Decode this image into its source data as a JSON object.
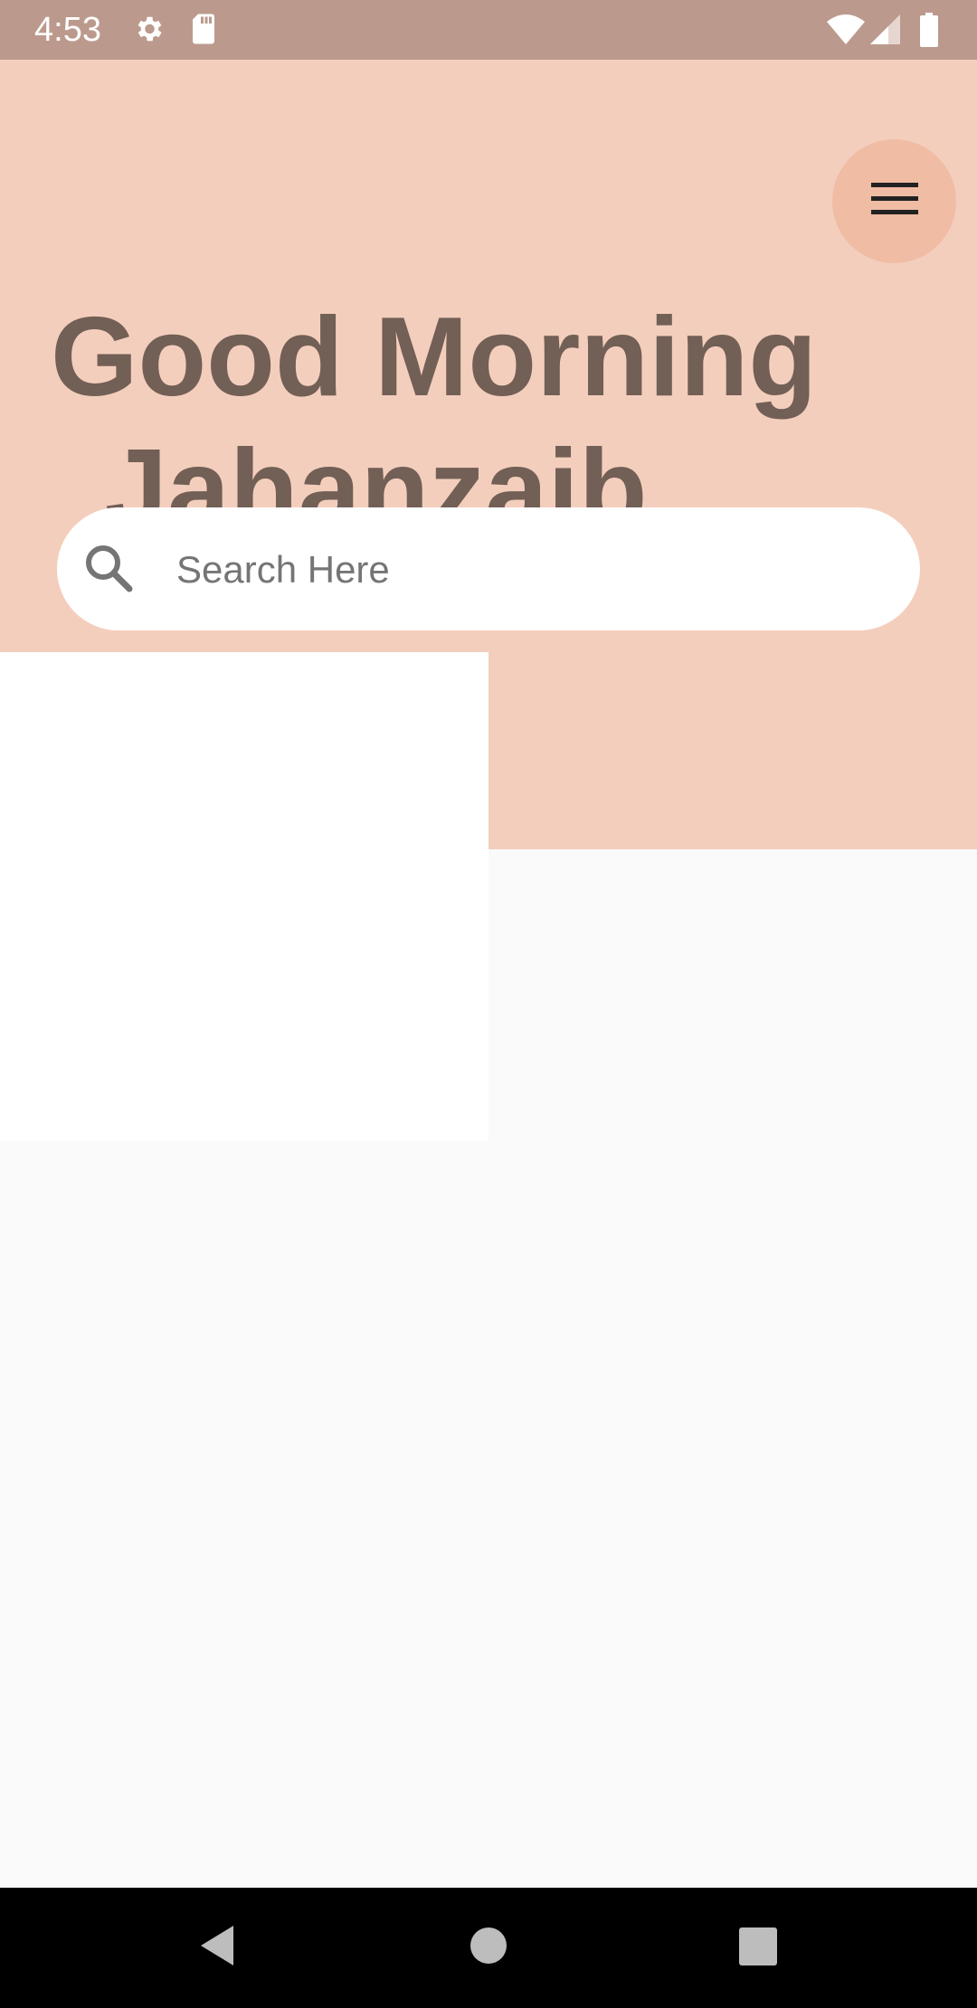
{
  "status_bar": {
    "time": "4:53",
    "icons": [
      "settings-icon",
      "sd-card-icon",
      "wifi-icon",
      "signal-icon",
      "battery-icon"
    ],
    "color": "#bb9a8d"
  },
  "header": {
    "background": "#f4cebd",
    "menu_icon": "hamburger-menu-icon",
    "greeting_line1": "Good Morning",
    "greeting_line2": "Jahanzaib",
    "text_color": "#725f55"
  },
  "search": {
    "icon": "search-icon",
    "placeholder": "Search Here",
    "value": ""
  },
  "nav_bar": {
    "buttons": [
      "back-icon",
      "home-icon",
      "recents-icon"
    ]
  }
}
